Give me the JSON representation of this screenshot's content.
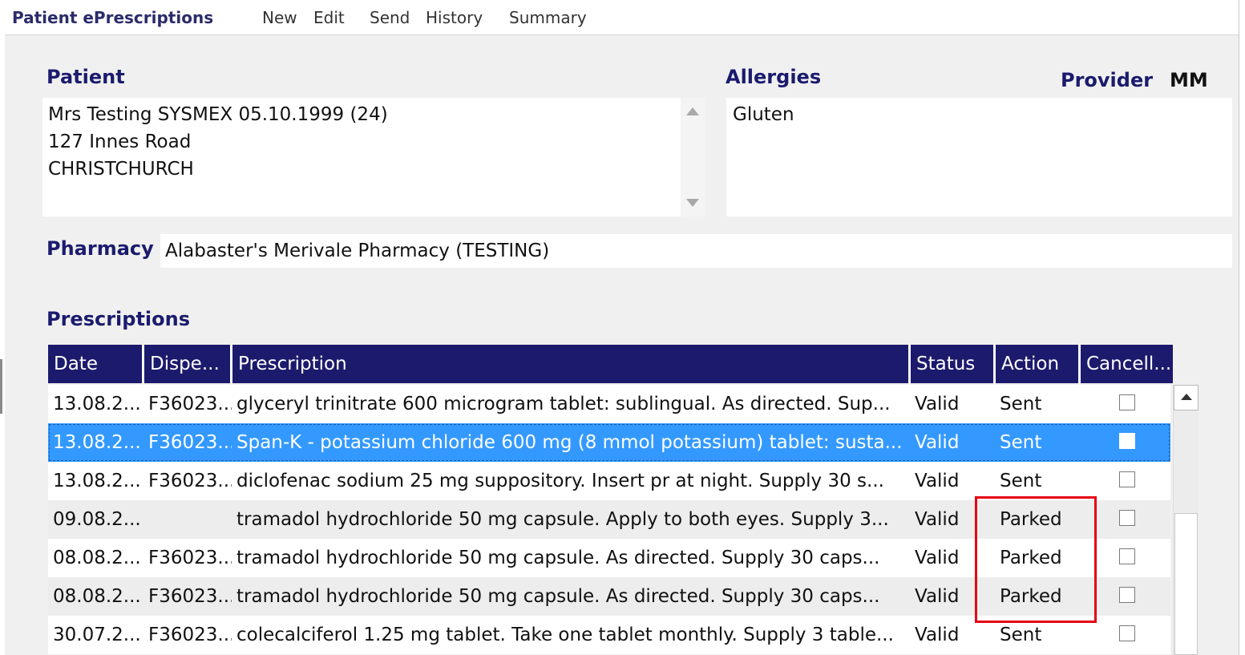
{
  "menubar": {
    "title": "Patient ePrescriptions",
    "items": [
      "New",
      "Edit",
      "Send",
      "History",
      "Summary"
    ]
  },
  "patient": {
    "label": "Patient",
    "lines": [
      "Mrs Testing SYSMEX 05.10.1999 (24)",
      "127 Innes Road",
      "CHRISTCHURCH"
    ]
  },
  "allergies": {
    "label": "Allergies",
    "value": "Gluten"
  },
  "provider": {
    "label": "Provider",
    "value": "MM"
  },
  "pharmacy": {
    "label": "Pharmacy",
    "value": "Alabaster's Merivale Pharmacy (TESTING)"
  },
  "prescriptions": {
    "label": "Prescriptions",
    "columns": [
      "Date",
      "Dispe...",
      "Prescription",
      "Status",
      "Action",
      "Cancell..."
    ],
    "rows": [
      {
        "date": "13.08.2...",
        "dispense": "F36023...",
        "prescription": "glyceryl trinitrate 600 microgram tablet: sublingual.  As directed.  Sup...",
        "status": "Valid",
        "action": "Sent",
        "cancelled": false,
        "selected": false
      },
      {
        "date": "13.08.2...",
        "dispense": "F36023...",
        "prescription": "Span-K - potassium chloride 600 mg (8 mmol potassium) tablet: susta...",
        "status": "Valid",
        "action": "Sent",
        "cancelled": false,
        "selected": true
      },
      {
        "date": "13.08.2...",
        "dispense": "F36023...",
        "prescription": "diclofenac sodium 25 mg suppository.  Insert pr at night.  Supply 30 s...",
        "status": "Valid",
        "action": "Sent",
        "cancelled": false,
        "selected": false
      },
      {
        "date": "09.08.2...",
        "dispense": "",
        "prescription": "tramadol hydrochloride 50 mg capsule.  Apply to both eyes.  Supply 3...",
        "status": "Valid",
        "action": "Parked",
        "cancelled": false,
        "selected": false
      },
      {
        "date": "08.08.2...",
        "dispense": "F36023...",
        "prescription": "tramadol hydrochloride 50 mg capsule.  As directed.  Supply 30 caps...",
        "status": "Valid",
        "action": "Parked",
        "cancelled": false,
        "selected": false
      },
      {
        "date": "08.08.2...",
        "dispense": "F36023...",
        "prescription": "tramadol hydrochloride 50 mg capsule.  As directed.  Supply 30 caps...",
        "status": "Valid",
        "action": "Parked",
        "cancelled": false,
        "selected": false
      },
      {
        "date": "30.07.2...",
        "dispense": "F36023...",
        "prescription": "colecalciferol 1.25 mg tablet.  Take one tablet monthly.  Supply 3 table...",
        "status": "Valid",
        "action": "Sent",
        "cancelled": false,
        "selected": false
      }
    ]
  },
  "colors": {
    "header_bg": "#1c1a6c",
    "label": "#1b1b6e",
    "selection": "#3399ff",
    "highlight_box": "#e60012"
  }
}
